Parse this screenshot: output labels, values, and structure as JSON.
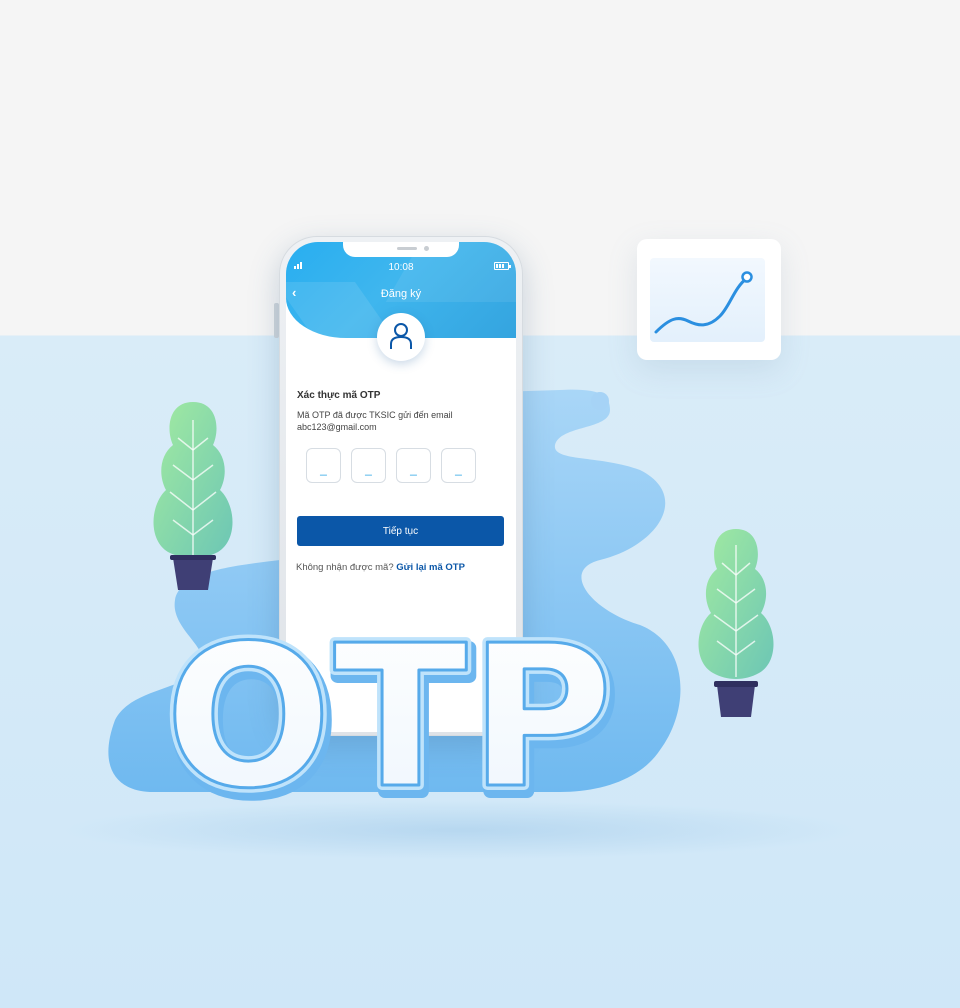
{
  "colors": {
    "accent": "#0b57a8",
    "header": "#2daef0",
    "blob": "#8cc7f4",
    "plant_leaf": "#8ee09a",
    "pot": "#3f3f75"
  },
  "phone": {
    "status_time": "10:08",
    "back_icon": "chevron-left-icon",
    "title": "Đăng ký",
    "avatar_icon": "user-icon",
    "otp_heading": "Xác thực mã OTP",
    "otp_desc_line1": "Mã OTP đã được TKSIC gửi đến email",
    "otp_desc_line2": "abc123@gmail.com",
    "otp_boxes": [
      "_",
      "_",
      "_",
      "_"
    ],
    "continue_label": "Tiếp tục",
    "resend_prompt": "Không nhận được mã?",
    "resend_link": "Gửi lại mã OTP"
  },
  "hero_text": "OTP",
  "chart_card_icon": "trend-line-icon"
}
